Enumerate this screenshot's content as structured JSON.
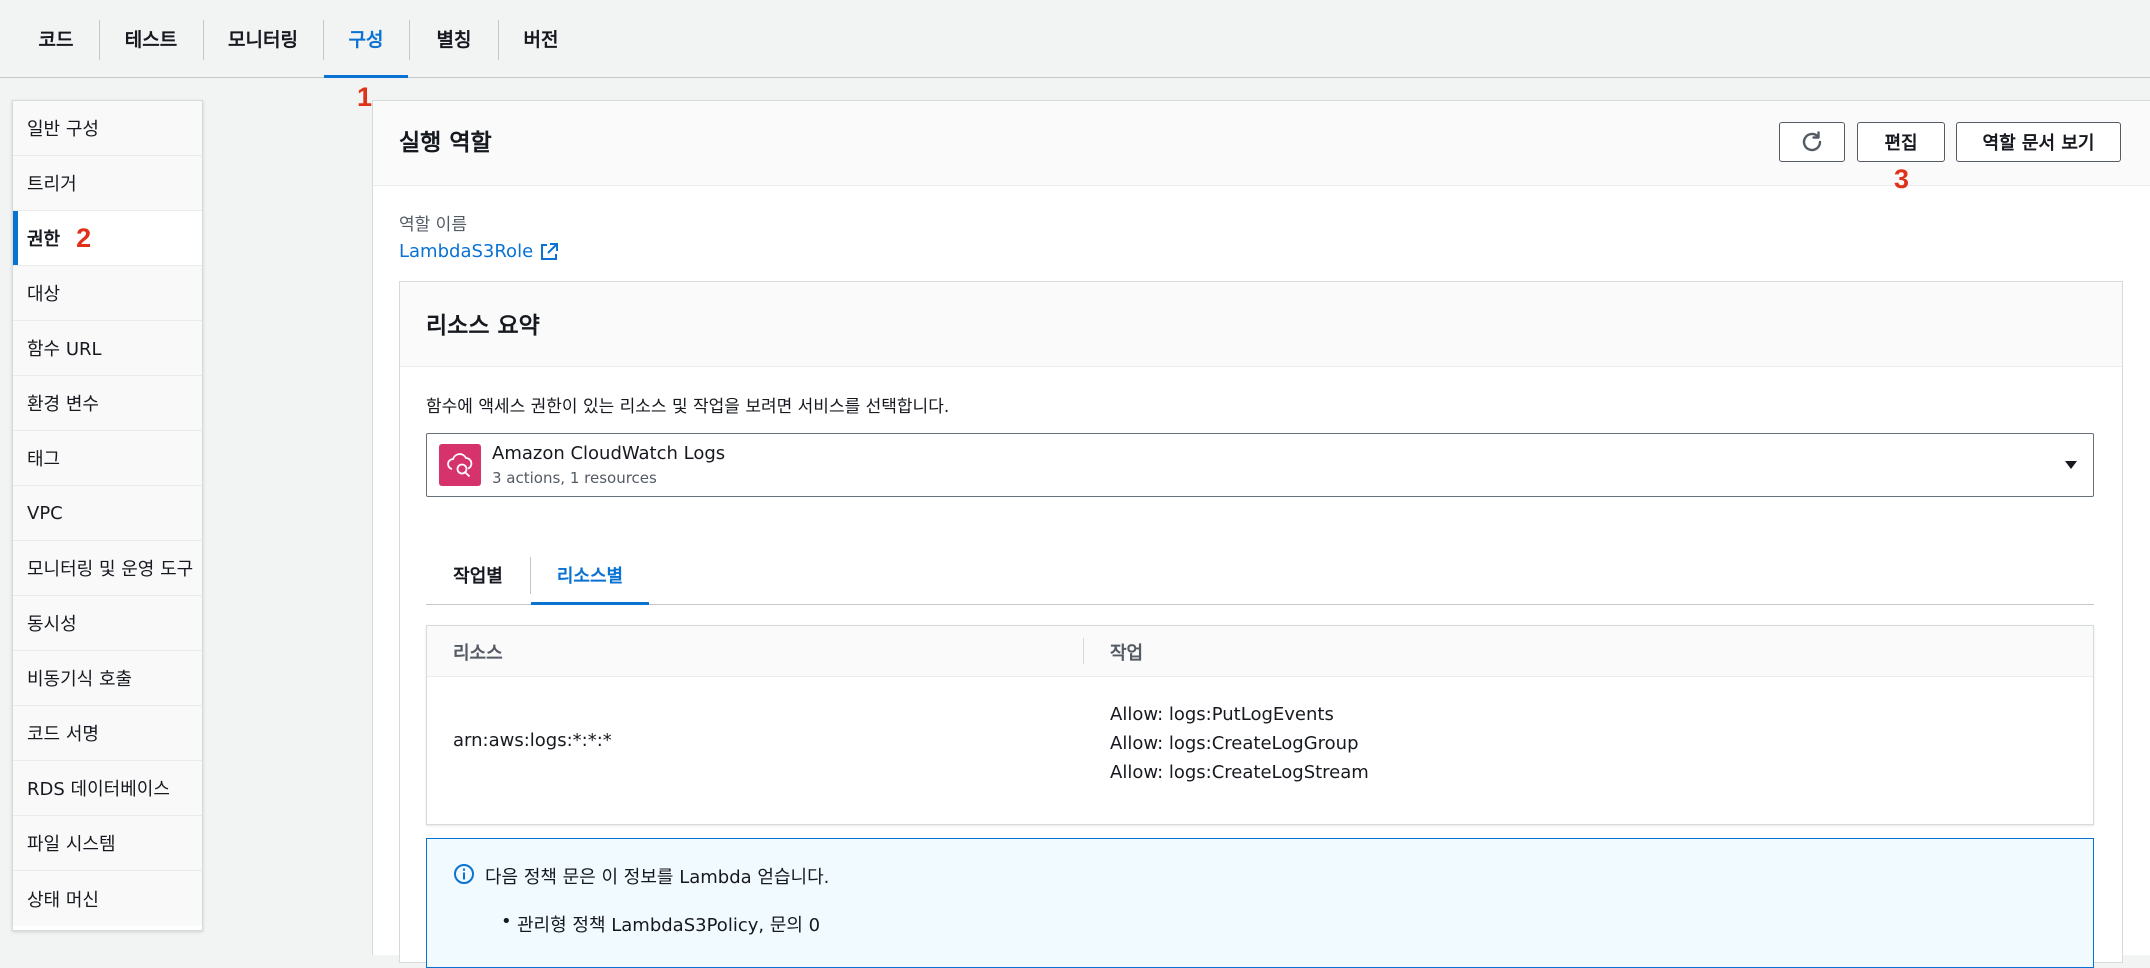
{
  "tabs": [
    {
      "label": "코드",
      "active": false
    },
    {
      "label": "테스트",
      "active": false
    },
    {
      "label": "모니터링",
      "active": false
    },
    {
      "label": "구성",
      "active": true
    },
    {
      "label": "별칭",
      "active": false
    },
    {
      "label": "버전",
      "active": false
    }
  ],
  "markers": {
    "one": "1",
    "two": "2",
    "three": "3"
  },
  "sidebar": {
    "items": [
      {
        "label": "일반 구성"
      },
      {
        "label": "트리거"
      },
      {
        "label": "권한"
      },
      {
        "label": "대상"
      },
      {
        "label": "함수 URL"
      },
      {
        "label": "환경 변수"
      },
      {
        "label": "태그"
      },
      {
        "label": "VPC"
      },
      {
        "label": "모니터링 및 운영 도구"
      },
      {
        "label": "동시성"
      },
      {
        "label": "비동기식 호출"
      },
      {
        "label": "코드 서명"
      },
      {
        "label": "RDS 데이터베이스"
      },
      {
        "label": "파일 시스템"
      },
      {
        "label": "상태 머신"
      }
    ],
    "active_index": 2
  },
  "execution_role": {
    "title": "실행 역할",
    "edit_label": "편집",
    "view_doc_label": "역할 문서 보기",
    "role_name_label": "역할 이름",
    "role_name": "LambdaS3Role"
  },
  "resource_summary": {
    "title": "리소스 요약",
    "description": "함수에 액세스 권한이 있는 리소스 및 작업을 보려면 서비스를 선택합니다.",
    "service": {
      "name": "Amazon CloudWatch Logs",
      "subtitle": "3 actions, 1 resources"
    },
    "subtabs": [
      {
        "label": "작업별",
        "active": false
      },
      {
        "label": "리소스별",
        "active": true
      }
    ],
    "table": {
      "headers": [
        "리소스",
        "작업"
      ],
      "rows": [
        {
          "resource": "arn:aws:logs:*:*:*",
          "actions": [
            "Allow: logs:PutLogEvents",
            "Allow: logs:CreateLogGroup",
            "Allow: logs:CreateLogStream"
          ]
        }
      ]
    }
  },
  "info": {
    "text": "다음 정책 문은 이 정보를 Lambda 얻습니다.",
    "bullet": "관리형 정책 LambdaS3Policy, 문의 0"
  },
  "colors": {
    "accent": "#0972d3",
    "marker": "#e0321b",
    "service_icon": "#d6336c"
  }
}
